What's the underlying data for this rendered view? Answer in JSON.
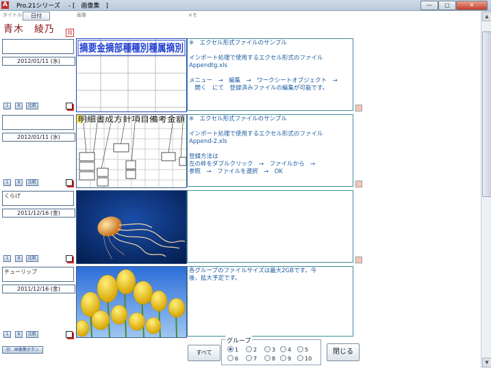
{
  "window": {
    "title": "Pro.21シリーズ　 - [　画像集　]",
    "min_label": "—",
    "max_label": "□",
    "close_label": "✕"
  },
  "header": {
    "title_label": "タイトル",
    "date_button": "日付",
    "image_label": "画像",
    "memo_label": "メモ",
    "user_name": "青木　綾乃",
    "user_mark": "岡"
  },
  "entries": [
    {
      "title": "",
      "date": "2012/01/11 (水)",
      "buttons": [
        "1",
        "8",
        "比較"
      ],
      "image": "spreadsheet-1",
      "memo": "※　エクセル形式ファイルのサンプル\n\nインポート処理で使用するエクセル形式のファイル\nAppendtg.xls\n\nメニュー　→　編集　→　ワークシートオブジェクト　→\n　開く　にて　登録済みファイルの編集が可能です。"
    },
    {
      "title": "",
      "date": "2012/01/11 (水)",
      "buttons": [
        "1",
        "8",
        "比較"
      ],
      "image": "spreadsheet-2",
      "memo": "※　エクセル形式ファイルのサンプル\n\nインポート処理で使用するエクセル形式のファイル\nAppend-2.xls\n\n登録方法は\n左の枠をダブルクリック　→　ファイルから　→\n参照　→　ファイルを選択　→　OK"
    },
    {
      "title": "くらげ",
      "date": "2011/12/16 (金)",
      "buttons": [
        "1",
        "8",
        "比較"
      ],
      "image": "jellyfish",
      "memo": ""
    },
    {
      "title": "チューリップ",
      "date": "2011/12/16 (金)",
      "buttons": [
        "1",
        "8",
        "比較"
      ],
      "image": "tulips",
      "memo": "各グループのファイルサイズは最大2GBです。今\n後、拡大予定です。"
    }
  ],
  "footer": {
    "nav_button": "旧　画像集ボタン",
    "all_button": "すべて",
    "group_label": "グループ",
    "groups": [
      "1",
      "2",
      "3",
      "4",
      "5",
      "6",
      "7",
      "8",
      "9",
      "10"
    ],
    "selected_group": "1",
    "close_button": "閉じる"
  },
  "spreadsheet_1_headers": [
    "摘要",
    "金",
    "摘",
    "部",
    "種",
    "種",
    "別",
    "種",
    "属",
    "摘",
    "別"
  ],
  "spreadsheet_2_headers": [
    "明細",
    "書",
    "成",
    "方",
    "針",
    "項",
    "目",
    "備",
    "考",
    "金",
    "額"
  ],
  "colors": {
    "accent": "#3a5a8a",
    "memo_text": "#1a5aa0",
    "user_name": "#8a1212"
  }
}
